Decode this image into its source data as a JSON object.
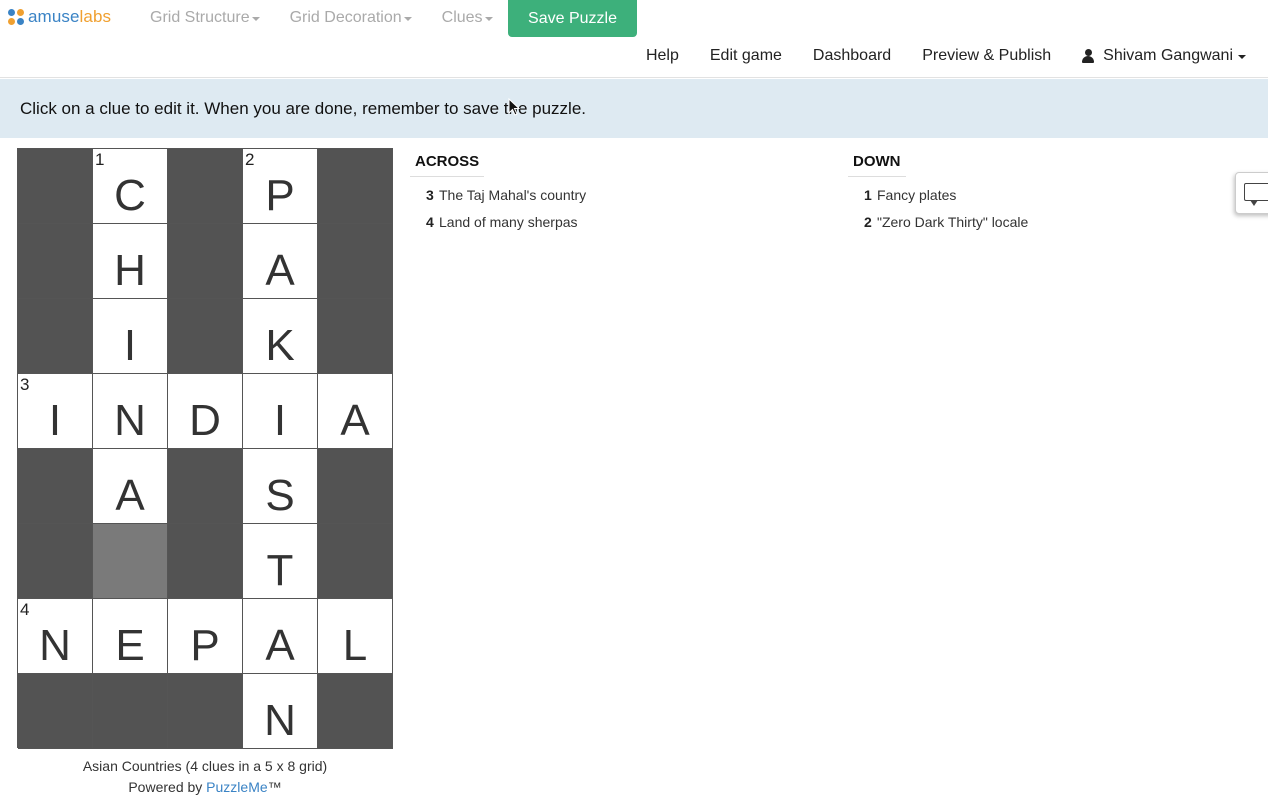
{
  "logo": {
    "part_a": "amuse",
    "part_b": "labs"
  },
  "top_menu": [
    {
      "label": "Grid Structure"
    },
    {
      "label": "Grid Decoration"
    },
    {
      "label": "Clues"
    }
  ],
  "save_label": "Save Puzzle",
  "nav": {
    "help": "Help",
    "edit_game": "Edit game",
    "dashboard": "Dashboard",
    "preview_publish": "Preview & Publish",
    "user_name": "Shivam Gangwani"
  },
  "banner_text": "Click on a clue to edit it. When you are done, remember to save the puzzle.",
  "grid": {
    "rows": [
      [
        {
          "t": "black"
        },
        {
          "n": "1",
          "l": "C"
        },
        {
          "t": "black"
        },
        {
          "n": "2",
          "l": "P"
        },
        {
          "t": "black"
        }
      ],
      [
        {
          "t": "black"
        },
        {
          "l": "H"
        },
        {
          "t": "black"
        },
        {
          "l": "A"
        },
        {
          "t": "black"
        }
      ],
      [
        {
          "t": "black"
        },
        {
          "l": "I"
        },
        {
          "t": "black"
        },
        {
          "l": "K"
        },
        {
          "t": "black"
        }
      ],
      [
        {
          "n": "3",
          "l": "I"
        },
        {
          "l": "N"
        },
        {
          "l": "D"
        },
        {
          "l": "I"
        },
        {
          "l": "A"
        }
      ],
      [
        {
          "t": "black"
        },
        {
          "l": "A"
        },
        {
          "t": "black"
        },
        {
          "l": "S"
        },
        {
          "t": "black"
        }
      ],
      [
        {
          "t": "black"
        },
        {
          "t": "shade"
        },
        {
          "t": "black"
        },
        {
          "l": "T"
        },
        {
          "t": "black"
        }
      ],
      [
        {
          "n": "4",
          "l": "N"
        },
        {
          "l": "E"
        },
        {
          "l": "P"
        },
        {
          "l": "A"
        },
        {
          "l": "L"
        }
      ],
      [
        {
          "t": "black"
        },
        {
          "t": "black"
        },
        {
          "t": "black"
        },
        {
          "l": "N"
        },
        {
          "t": "black"
        }
      ]
    ]
  },
  "caption": {
    "line1": "Asian Countries (4 clues in a 5 x 8 grid)",
    "powered_prefix": "Powered by ",
    "powered_link": "PuzzleMe",
    "powered_suffix": "™"
  },
  "across": {
    "heading": "ACROSS",
    "clues": [
      {
        "num": "3",
        "text": "The Taj Mahal's country"
      },
      {
        "num": "4",
        "text": "Land of many sherpas"
      }
    ]
  },
  "down": {
    "heading": "DOWN",
    "clues": [
      {
        "num": "1",
        "text": "Fancy plates"
      },
      {
        "num": "2",
        "text": "\"Zero Dark Thirty\" locale"
      }
    ]
  },
  "colors": {
    "save_button": "#3db07b",
    "banner_bg": "#deeaf2",
    "black_cell": "#535353",
    "link": "#3a83c5",
    "logo_orange": "#f0a030"
  },
  "icons": {
    "user": "user-icon",
    "feedback": "chat-bubble-icon"
  }
}
